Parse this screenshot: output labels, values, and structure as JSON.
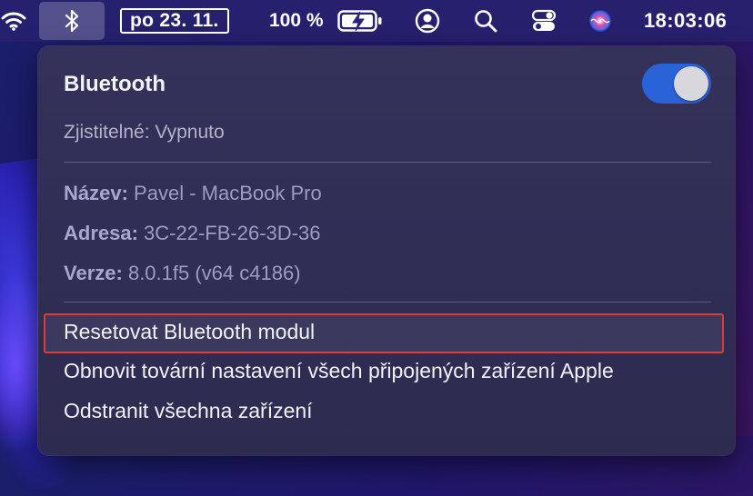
{
  "menubar": {
    "date": "po 23. 11.",
    "battery_percent": "100 %",
    "clock": "18:03:06",
    "icons": [
      "wifi-icon",
      "bluetooth-icon",
      "battery-charging-icon",
      "user-icon",
      "search-icon",
      "control-center-icon",
      "siri-icon"
    ]
  },
  "bluetooth_menu": {
    "title": "Bluetooth",
    "toggle_on": true,
    "discoverable": "Zjistitelné: Vypnuto",
    "info": [
      {
        "key": "Název:",
        "value": "Pavel - MacBook Pro"
      },
      {
        "key": "Adresa:",
        "value": "3C-22-FB-26-3D-36"
      },
      {
        "key": "Verze:",
        "value": "8.0.1f5 (v64 c4186)"
      }
    ],
    "actions": [
      "Resetovat Bluetooth modul",
      "Obnovit tovární nastavení všech připojených zařízení Apple",
      "Odstranit všechna zařízení"
    ]
  },
  "colors": {
    "toggle_accent": "#2a63d8",
    "highlight_border": "#e03c36"
  }
}
